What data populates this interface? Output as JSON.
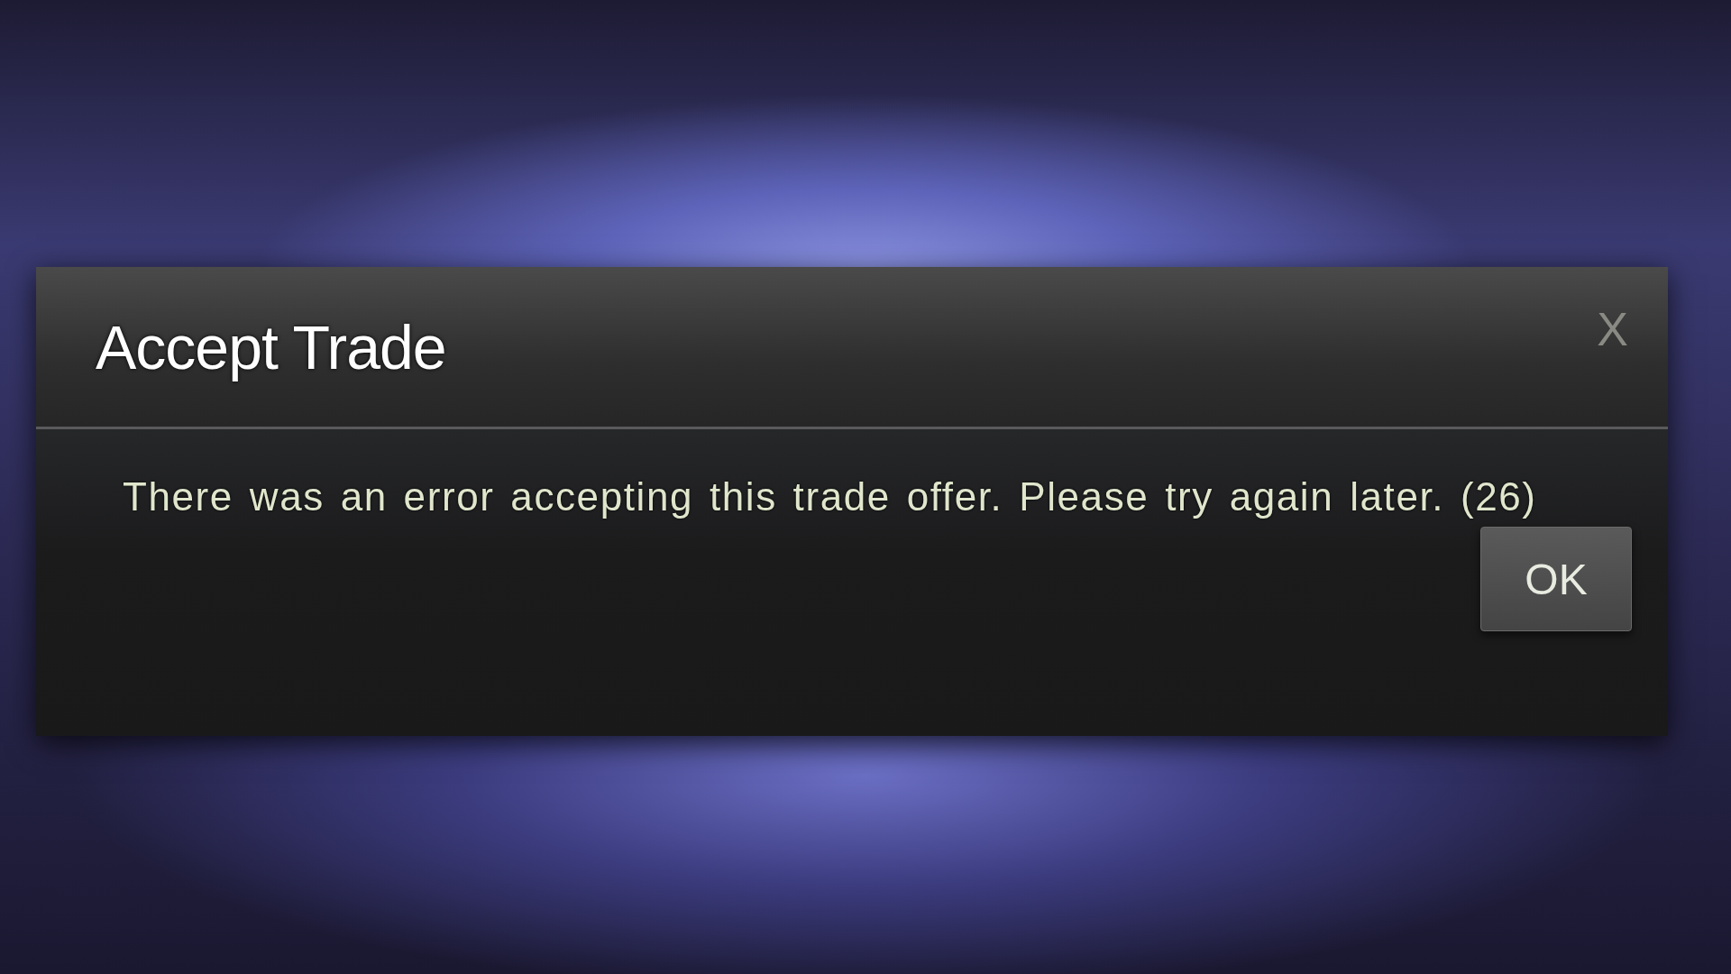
{
  "dialog": {
    "title": "Accept Trade",
    "close": "X",
    "message": "There was an error accepting this trade offer. Please try again later. (26)",
    "buttons": [
      "OK"
    ]
  }
}
